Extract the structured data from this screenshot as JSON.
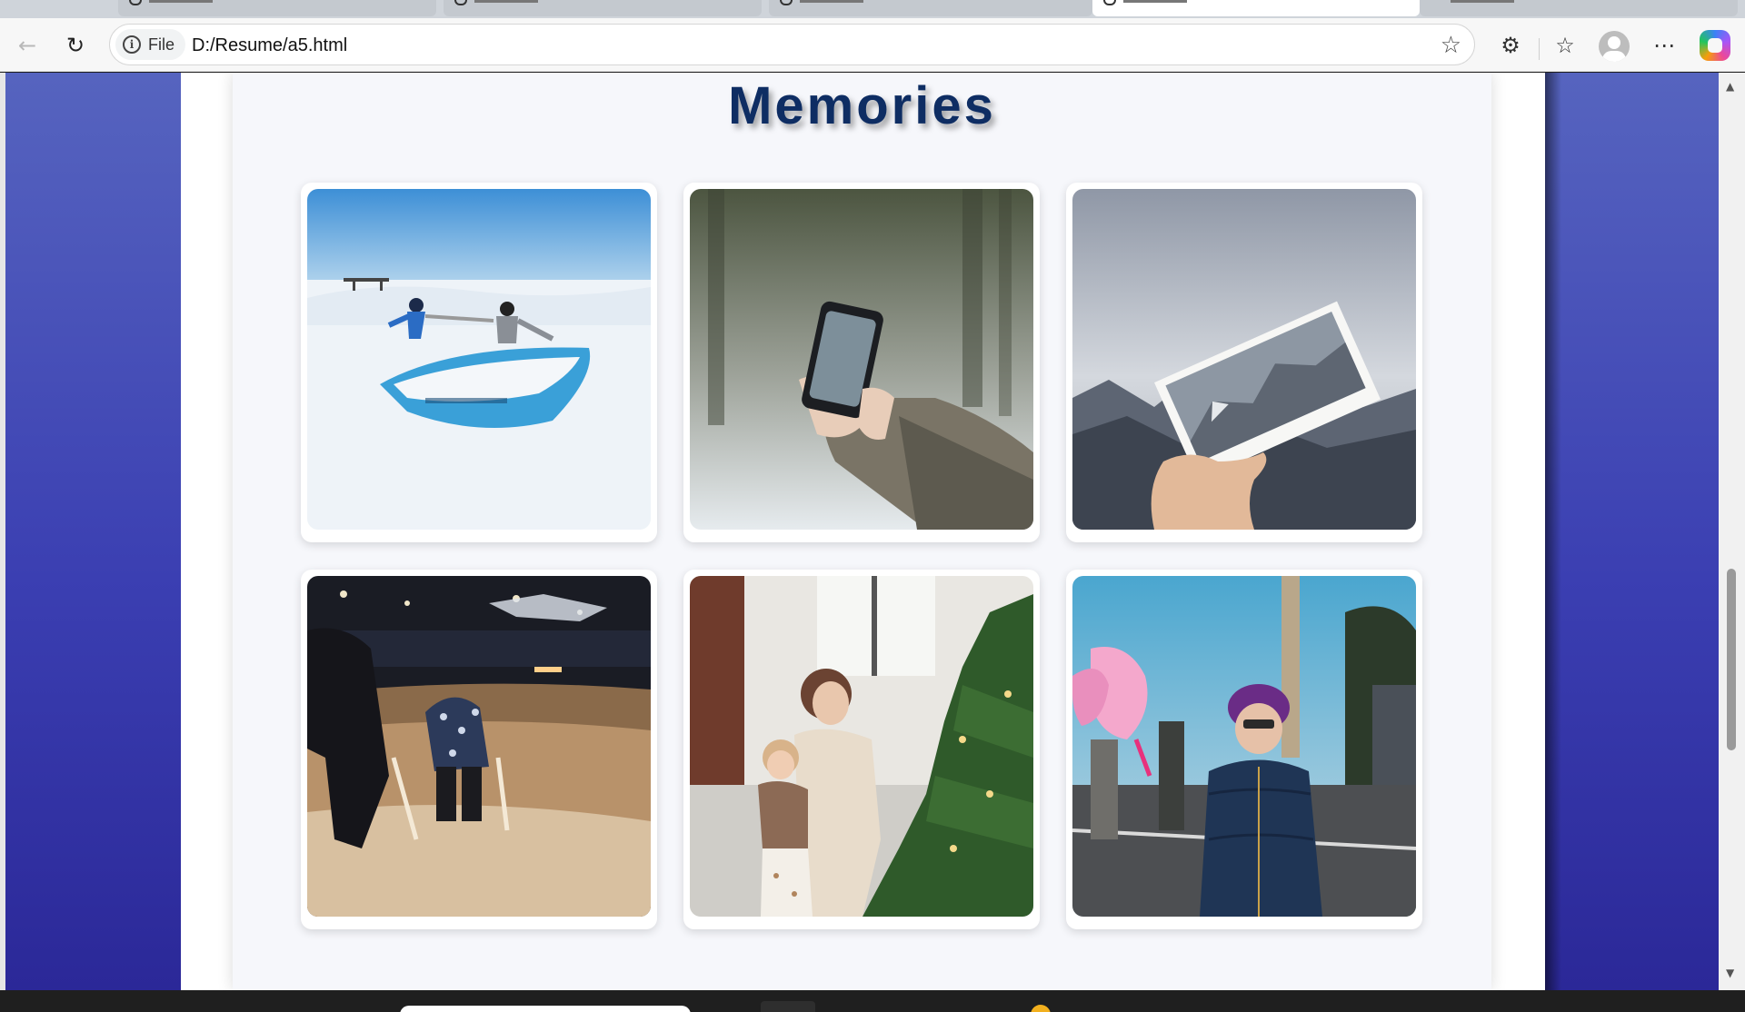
{
  "browser": {
    "tabs": [
      "",
      "",
      "",
      "",
      ""
    ],
    "address": {
      "chip_label": "File",
      "url": "D:/Resume/a5.html"
    },
    "toolbar_icons": [
      "back-icon",
      "reload-icon",
      "info-icon",
      "star-icon",
      "extensions-icon",
      "favorites-icon",
      "profile-icon",
      "more-icon",
      "copilot-icon"
    ]
  },
  "page": {
    "title": "Memories",
    "gallery": [
      {
        "subject": "snow-boat-photo"
      },
      {
        "subject": "phone-snow-photo"
      },
      {
        "subject": "polaroid-mountain-photo"
      },
      {
        "subject": "night-skating-photo"
      },
      {
        "subject": "christmas-tree-photo"
      },
      {
        "subject": "cotton-candy-photo"
      }
    ]
  },
  "colors": {
    "background_gradient_top": "#5664bf",
    "background_gradient_bottom": "#2b2898",
    "title": "#0e2d63",
    "card": "#f6f7fb"
  }
}
